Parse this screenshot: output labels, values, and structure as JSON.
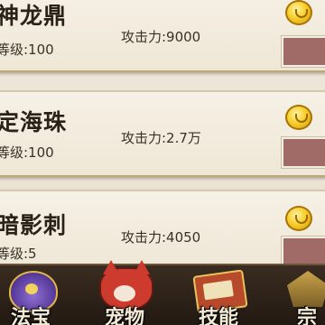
{
  "items": [
    {
      "name": "神龙鼎",
      "level": "等级:100",
      "attack": "攻击力:9000"
    },
    {
      "name": "定海珠",
      "level": "等级:100",
      "attack": "攻击力:2.7万"
    },
    {
      "name": "暗影刺",
      "level": "等级:5",
      "attack": "攻击力:4050"
    }
  ],
  "tabs": [
    {
      "label": "法宝",
      "icon": "fabao-icon"
    },
    {
      "label": "宠物",
      "icon": "pet-icon"
    },
    {
      "label": "技能",
      "icon": "skill-icon"
    },
    {
      "label": "宗",
      "icon": "sect-icon"
    }
  ],
  "colors": {
    "buy_button": "#a06b66",
    "coin": "#f7cf2c",
    "tabbar": "#2a2018"
  }
}
